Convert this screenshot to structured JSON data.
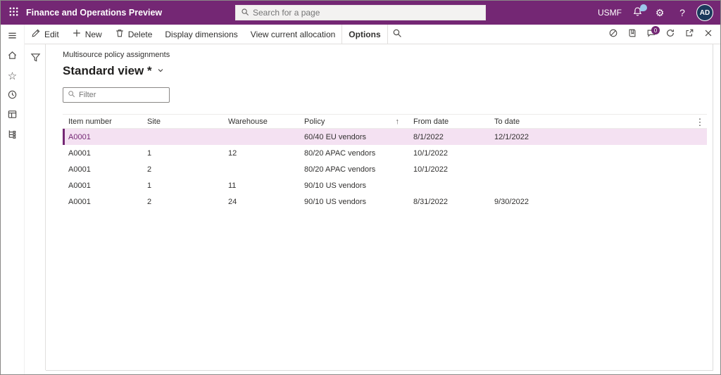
{
  "colors": {
    "accent": "#742774",
    "selection_bg": "#f4e1f2",
    "badge_blue": "#9cc7ea",
    "corner_blue": "#2b7cd3"
  },
  "icons": {
    "gear": "⚙",
    "help": "?",
    "favorites_star": "☆",
    "ellipsis_vertical": "⋮"
  },
  "topbar": {
    "title": "Finance and Operations Preview",
    "search_placeholder": "Search for a page",
    "company": "USMF",
    "avatar_initials": "AD"
  },
  "action_pane": {
    "edit_label": "Edit",
    "new_label": "New",
    "delete_label": "Delete",
    "display_dimensions_label": "Display dimensions",
    "view_current_allocation_label": "View current allocation",
    "options_label": "Options",
    "messages_badge": "0"
  },
  "page": {
    "breadcrumb": "Multisource policy assignments",
    "view_title": "Standard view *",
    "filter_placeholder": "Filter"
  },
  "grid": {
    "columns": [
      "Item number",
      "Site",
      "Warehouse",
      "Policy",
      "From date",
      "To date"
    ],
    "sort": {
      "column": "Policy",
      "direction": "ascending",
      "indicator": "↑"
    },
    "rows": [
      {
        "selected": true,
        "cells": [
          "A0001",
          "",
          "",
          "60/40 EU vendors",
          "8/1/2022",
          "12/1/2022"
        ]
      },
      {
        "selected": false,
        "cells": [
          "A0001",
          "1",
          "12",
          "80/20 APAC vendors",
          "10/1/2022",
          ""
        ]
      },
      {
        "selected": false,
        "cells": [
          "A0001",
          "2",
          "",
          "80/20 APAC vendors",
          "10/1/2022",
          ""
        ]
      },
      {
        "selected": false,
        "cells": [
          "A0001",
          "1",
          "11",
          "90/10 US vendors",
          "",
          ""
        ]
      },
      {
        "selected": false,
        "cells": [
          "A0001",
          "2",
          "24",
          "90/10 US vendors",
          "8/31/2022",
          "9/30/2022"
        ]
      }
    ]
  }
}
